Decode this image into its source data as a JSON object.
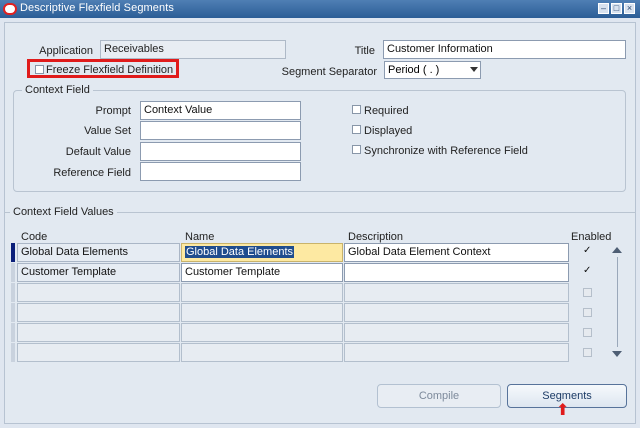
{
  "window": {
    "title": "Descriptive Flexfield Segments"
  },
  "header": {
    "application_label": "Application",
    "application_value": "Receivables",
    "title_label": "Title",
    "title_value": "Customer Information",
    "freeze_label": "Freeze Flexfield Definition",
    "segment_separator_label": "Segment Separator",
    "segment_separator_value": "Period ( . )"
  },
  "context_field": {
    "group_label": "Context Field",
    "prompt_label": "Prompt",
    "prompt_value": "Context Value",
    "value_set_label": "Value Set",
    "value_set_value": "",
    "default_value_label": "Default Value",
    "default_value_value": "",
    "reference_field_label": "Reference Field",
    "reference_field_value": "",
    "required_label": "Required",
    "displayed_label": "Displayed",
    "synchronize_label": "Synchronize with Reference Field"
  },
  "context_values": {
    "group_label": "Context Field Values",
    "columns": [
      "Code",
      "Name",
      "Description",
      "Enabled"
    ],
    "rows": [
      {
        "code": "Global Data Elements",
        "name": "Global Data Elements",
        "description": "Global Data Element Context",
        "enabled": true
      },
      {
        "code": "Customer Template",
        "name": "Customer Template",
        "description": "",
        "enabled": true
      },
      {
        "code": "",
        "name": "",
        "description": "",
        "enabled": false
      },
      {
        "code": "",
        "name": "",
        "description": "",
        "enabled": false
      },
      {
        "code": "",
        "name": "",
        "description": "",
        "enabled": false
      },
      {
        "code": "",
        "name": "",
        "description": "",
        "enabled": false
      }
    ]
  },
  "buttons": {
    "compile": "Compile",
    "segments": "Segments"
  },
  "colors": {
    "highlight": "#e01b1b",
    "titlebar": "#2b5d96",
    "selection": "#1f4d8e",
    "name_cell": "#fde9a2"
  }
}
